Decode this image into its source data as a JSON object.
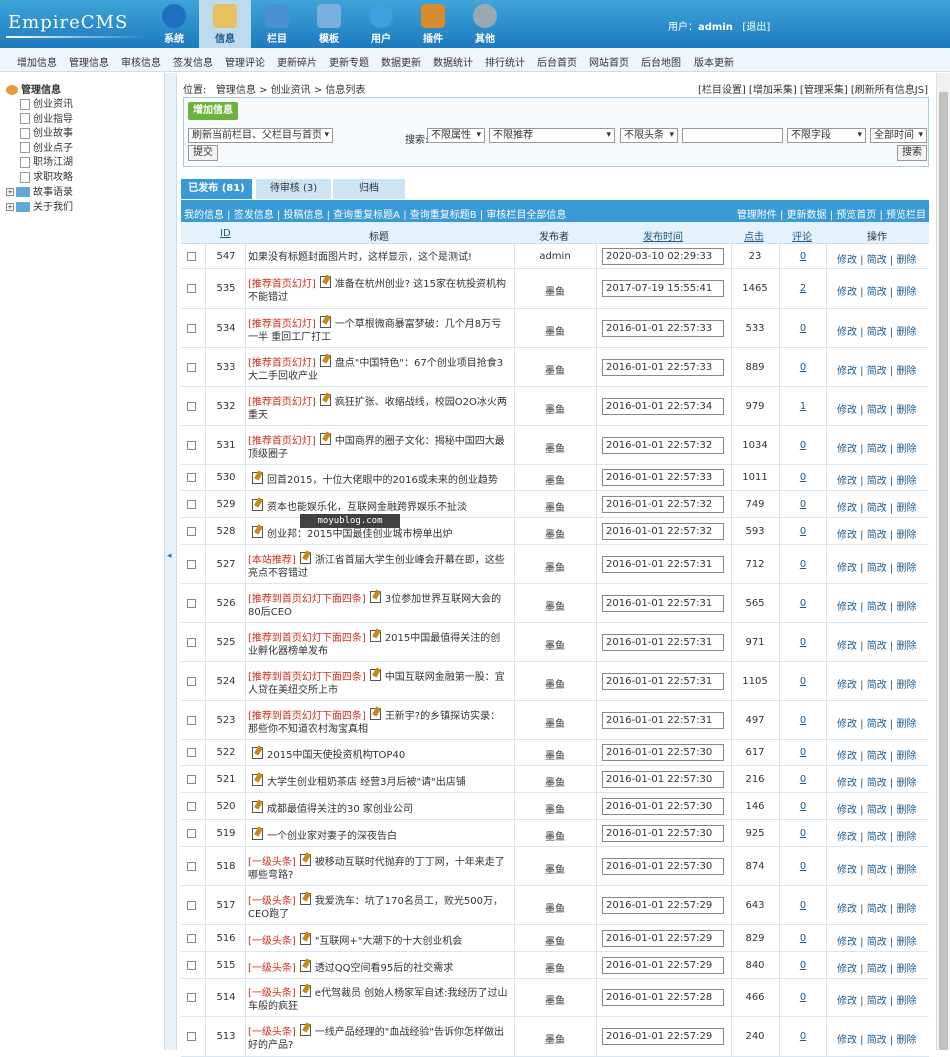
{
  "app": {
    "logo": "EmpireCMS"
  },
  "nav": [
    {
      "label": "系统",
      "icon": "globe-icon"
    },
    {
      "label": "信息",
      "icon": "notepad-icon",
      "active": true
    },
    {
      "label": "栏目",
      "icon": "folder-icon"
    },
    {
      "label": "模板",
      "icon": "window-icon"
    },
    {
      "label": "用户",
      "icon": "user-icon"
    },
    {
      "label": "插件",
      "icon": "tools-icon"
    },
    {
      "label": "其他",
      "icon": "gear-icon"
    }
  ],
  "user": {
    "prefix": "用户：",
    "name": "admin",
    "logout": "[退出]"
  },
  "subnav": [
    "增加信息",
    "管理信息",
    "审核信息",
    "签发信息",
    "管理评论",
    "更新碎片",
    "更新专题",
    "数据更新",
    "数据统计",
    "排行统计",
    "后台首页",
    "网站首页",
    "后台地图",
    "版本更新"
  ],
  "sidebar": {
    "root": "管理信息",
    "items": [
      "创业资讯",
      "创业指导",
      "创业故事",
      "创业点子",
      "职场江湖",
      "求职攻略"
    ],
    "folders": [
      "故事语录",
      "关于我们"
    ]
  },
  "breadcrumb": {
    "prefix": "位置:",
    "parts": [
      "管理信息",
      "创业资讯",
      "信息列表"
    ],
    "sep": " > "
  },
  "crumb_links": "[栏目设置] [增加采集] [管理采集] [刷新所有信息JS]",
  "toolbar": {
    "add_button": "增加信息",
    "refresh_select": "刷新当前栏目、父栏目与首页",
    "submit": "提交",
    "search_label": "搜索:",
    "filters": [
      "不限属性",
      "不限推荐",
      "不限头条"
    ],
    "field_select": "不限字段",
    "time_select": "全部时间",
    "search_button": "搜索"
  },
  "tabs": [
    "已发布 (81)",
    "待审核 (3)",
    "归档"
  ],
  "tablebar": {
    "left": "我的信息 | 签发信息 | 投稿信息 | 查询重复标题A | 查询重复标题B | 审核栏目全部信息",
    "right": "管理附件 | 更新数据 | 预览首页 | 预览栏目"
  },
  "columns": {
    "id": "ID",
    "title": "标题",
    "publisher": "发布者",
    "time": "发布时间",
    "clicks": "点击",
    "comments": "评论",
    "ops": "操作"
  },
  "ops_label": "修改 | 简改 | 删除",
  "watermark": "moyublog.com",
  "rows": [
    {
      "id": "547",
      "tag": "",
      "edit": false,
      "title": "如果没有标题封面图片时，这样显示，这个是测试!",
      "publisher": "admin",
      "time": "2020-03-10 02:29:33",
      "clicks": "23",
      "comments": "0"
    },
    {
      "id": "535",
      "tag": "[推荐首页幻灯]",
      "edit": true,
      "title": "准备在杭州创业? 这15家在杭投资机构不能错过",
      "publisher": "墨鱼",
      "time": "2017-07-19 15:55:41",
      "clicks": "1465",
      "comments": "2"
    },
    {
      "id": "534",
      "tag": "[推荐首页幻灯]",
      "edit": true,
      "title": "一个草根微商暴富梦破：几个月8万亏一半 重回工厂打工",
      "publisher": "墨鱼",
      "time": "2016-01-01 22:57:33",
      "clicks": "533",
      "comments": "0"
    },
    {
      "id": "533",
      "tag": "[推荐首页幻灯]",
      "edit": true,
      "title": "盘点\"中国特色\"：67个创业项目抢食3大二手回收产业",
      "publisher": "墨鱼",
      "time": "2016-01-01 22:57:33",
      "clicks": "889",
      "comments": "0"
    },
    {
      "id": "532",
      "tag": "[推荐首页幻灯]",
      "edit": true,
      "title": "疯狂扩张、收缩战线，校园O2O冰火两重天",
      "publisher": "墨鱼",
      "time": "2016-01-01 22:57:34",
      "clicks": "979",
      "comments": "1"
    },
    {
      "id": "531",
      "tag": "[推荐首页幻灯]",
      "edit": true,
      "title": "中国商界的圈子文化：揭秘中国四大最顶级圈子",
      "publisher": "墨鱼",
      "time": "2016-01-01 22:57:32",
      "clicks": "1034",
      "comments": "0"
    },
    {
      "id": "530",
      "tag": "",
      "edit": true,
      "title": "回首2015，十位大佬眼中的2016或未来的创业趋势",
      "publisher": "墨鱼",
      "time": "2016-01-01 22:57:33",
      "clicks": "1011",
      "comments": "0"
    },
    {
      "id": "529",
      "tag": "",
      "edit": true,
      "title": "资本也能娱乐化，互联网金融跨界娱乐不扯淡",
      "publisher": "墨鱼",
      "time": "2016-01-01 22:57:32",
      "clicks": "749",
      "comments": "0"
    },
    {
      "id": "528",
      "tag": "",
      "edit": true,
      "title": "创业邦：2015中国最佳创业城市榜单出炉",
      "publisher": "墨鱼",
      "time": "2016-01-01 22:57:32",
      "clicks": "593",
      "comments": "0"
    },
    {
      "id": "527",
      "tag": "[本站推荐]",
      "edit": true,
      "title": "浙江省首届大学生创业峰会开幕在即，这些亮点不容错过",
      "publisher": "墨鱼",
      "time": "2016-01-01 22:57:31",
      "clicks": "712",
      "comments": "0"
    },
    {
      "id": "526",
      "tag": "[推荐到首页幻灯下面四条]",
      "edit": true,
      "title": "3位参加世界互联网大会的80后CEO",
      "publisher": "墨鱼",
      "time": "2016-01-01 22:57:31",
      "clicks": "565",
      "comments": "0"
    },
    {
      "id": "525",
      "tag": "[推荐到首页幻灯下面四条]",
      "edit": true,
      "title": "2015中国最值得关注的创业孵化器榜单发布",
      "publisher": "墨鱼",
      "time": "2016-01-01 22:57:31",
      "clicks": "971",
      "comments": "0"
    },
    {
      "id": "524",
      "tag": "[推荐到首页幻灯下面四条]",
      "edit": true,
      "title": "中国互联网金融第一股：宜人贷在美纽交所上市",
      "publisher": "墨鱼",
      "time": "2016-01-01 22:57:31",
      "clicks": "1105",
      "comments": "0"
    },
    {
      "id": "523",
      "tag": "[推荐到首页幻灯下面四条]",
      "edit": true,
      "title": "王新宇?的乡镇探访实录：那些你不知道农村淘宝真相",
      "publisher": "墨鱼",
      "time": "2016-01-01 22:57:31",
      "clicks": "497",
      "comments": "0"
    },
    {
      "id": "522",
      "tag": "",
      "edit": true,
      "title": "2015中国天使投资机构TOP40",
      "publisher": "墨鱼",
      "time": "2016-01-01 22:57:30",
      "clicks": "617",
      "comments": "0"
    },
    {
      "id": "521",
      "tag": "",
      "edit": true,
      "title": "大学生创业租奶茶店 经营3月后被\"请\"出店铺",
      "publisher": "墨鱼",
      "time": "2016-01-01 22:57:30",
      "clicks": "216",
      "comments": "0"
    },
    {
      "id": "520",
      "tag": "",
      "edit": true,
      "title": "成都最值得关注的30 家创业公司",
      "publisher": "墨鱼",
      "time": "2016-01-01 22:57:30",
      "clicks": "146",
      "comments": "0"
    },
    {
      "id": "519",
      "tag": "",
      "edit": true,
      "title": "一个创业家对妻子的深夜告白",
      "publisher": "墨鱼",
      "time": "2016-01-01 22:57:30",
      "clicks": "925",
      "comments": "0"
    },
    {
      "id": "518",
      "tag": "[一级头条]",
      "edit": true,
      "title": "被移动互联时代抛弃的丁丁网，十年来走了哪些弯路?",
      "publisher": "墨鱼",
      "time": "2016-01-01 22:57:30",
      "clicks": "874",
      "comments": "0"
    },
    {
      "id": "517",
      "tag": "[一级头条]",
      "edit": true,
      "title": "我爱洗车：坑了170名员工，败光500万，CEO跑了",
      "publisher": "墨鱼",
      "time": "2016-01-01 22:57:29",
      "clicks": "643",
      "comments": "0"
    },
    {
      "id": "516",
      "tag": "[一级头条]",
      "edit": true,
      "title": "\"互联网+\"大潮下的十大创业机会",
      "publisher": "墨鱼",
      "time": "2016-01-01 22:57:29",
      "clicks": "829",
      "comments": "0"
    },
    {
      "id": "515",
      "tag": "[一级头条]",
      "edit": true,
      "title": "透过QQ空间看95后的社交需求",
      "publisher": "墨鱼",
      "time": "2016-01-01 22:57:29",
      "clicks": "840",
      "comments": "0"
    },
    {
      "id": "514",
      "tag": "[一级头条]",
      "edit": true,
      "title": "e代驾裁员 创始人杨家军自述:我经历了过山车般的疯狂",
      "publisher": "墨鱼",
      "time": "2016-01-01 22:57:28",
      "clicks": "466",
      "comments": "0"
    },
    {
      "id": "513",
      "tag": "[一级头条]",
      "edit": true,
      "title": "一线产品经理的\"血战经验\"告诉你怎样做出好的产品?",
      "publisher": "墨鱼",
      "time": "2016-01-01 22:57:29",
      "clicks": "240",
      "comments": "0"
    }
  ]
}
